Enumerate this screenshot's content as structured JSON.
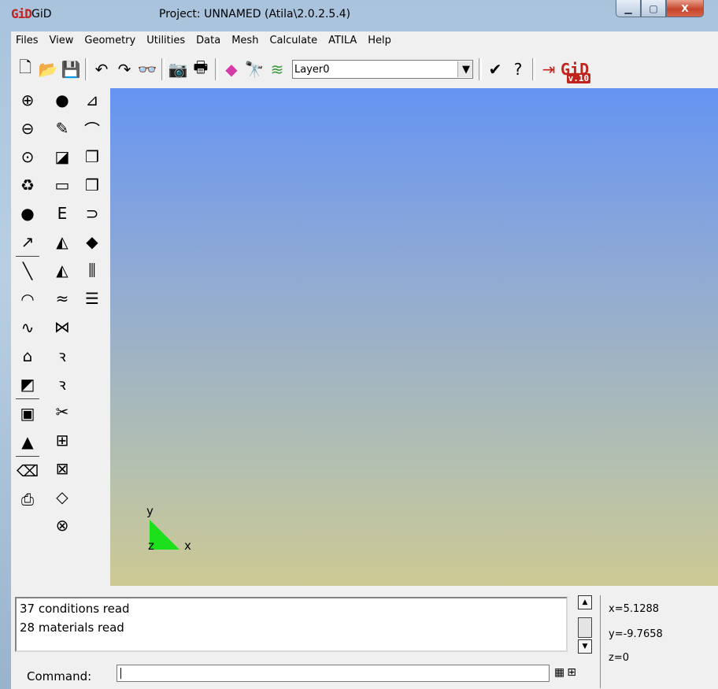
{
  "window": {
    "logo": "GiD",
    "app_name": "GiD",
    "title": "Project: UNNAMED (Atila\\2.0.2.5.4)",
    "buttons": {
      "minimize": "▁",
      "maximize": "▢",
      "close": "X"
    }
  },
  "menu": [
    "Files",
    "View",
    "Geometry",
    "Utilities",
    "Data",
    "Mesh",
    "Calculate",
    "ATILA",
    "Help"
  ],
  "toolbar": {
    "layer_select": "Layer0",
    "logo_version": "v.10",
    "icons_left": [
      {
        "name": "new-file-icon",
        "glyph": "🗋"
      },
      {
        "name": "open-folder-icon",
        "glyph": "📂"
      },
      {
        "name": "save-icon",
        "glyph": "💾"
      },
      {
        "name": "undo-view-icon",
        "glyph": "↶"
      },
      {
        "name": "redo-view-icon",
        "glyph": "↷"
      },
      {
        "name": "view-glasses-icon",
        "glyph": "👓"
      },
      {
        "name": "camera-icon",
        "glyph": "📷"
      },
      {
        "name": "print-icon",
        "glyph": "🖶"
      },
      {
        "name": "rainbow-render-icon",
        "glyph": "◆"
      },
      {
        "name": "binoculars-icon",
        "glyph": "🔭"
      },
      {
        "name": "layers-icon",
        "glyph": "≋"
      }
    ],
    "icons_right": [
      {
        "name": "check-icon",
        "glyph": "✔"
      },
      {
        "name": "help-icon",
        "glyph": "?"
      },
      {
        "name": "exit-icon",
        "glyph": "⇥"
      }
    ]
  },
  "leftbar": {
    "col1": [
      {
        "name": "zoom-in-icon",
        "glyph": "⊕"
      },
      {
        "name": "zoom-out-icon",
        "glyph": "⊖"
      },
      {
        "name": "zoom-frame-icon",
        "glyph": "⊙"
      },
      {
        "name": "redraw-recycle-icon",
        "glyph": "♻"
      },
      {
        "name": "render-sphere-icon",
        "glyph": "●"
      },
      {
        "name": "point-arrow-icon",
        "glyph": "↗"
      },
      {
        "name": "line-icon",
        "glyph": "╲"
      },
      {
        "name": "arc-icon",
        "glyph": "◠"
      },
      {
        "name": "nurbs-curve-icon",
        "glyph": "∿"
      },
      {
        "name": "polyline-icon",
        "glyph": "⌂"
      },
      {
        "name": "surface-icon",
        "glyph": "◩"
      },
      {
        "name": "volume-box-icon",
        "glyph": "▣"
      },
      {
        "name": "solid-shapes-icon",
        "glyph": "▲"
      },
      {
        "name": "eraser-icon",
        "glyph": "⌫"
      },
      {
        "name": "list-entities-icon",
        "glyph": "⎙"
      }
    ],
    "col2": [
      {
        "name": "point-icon",
        "glyph": "●"
      },
      {
        "name": "edit-note-icon",
        "glyph": "✎"
      },
      {
        "name": "eraser-small-icon",
        "glyph": "◪"
      },
      {
        "name": "select-box-icon",
        "glyph": "▭"
      },
      {
        "name": "label-e-icon",
        "glyph": "E"
      },
      {
        "name": "surface-patch-icon",
        "glyph": "◭"
      },
      {
        "name": "surface-patch-2-icon",
        "glyph": "◭"
      },
      {
        "name": "sweep-surface-icon",
        "glyph": "≈"
      },
      {
        "name": "intersect-icon",
        "glyph": "⋈"
      },
      {
        "name": "divide-curve-icon",
        "glyph": "ꝛ"
      },
      {
        "name": "divide-curve-2-icon",
        "glyph": "ꝛ"
      },
      {
        "name": "cut-scissors-icon",
        "glyph": "✂"
      },
      {
        "name": "structured-mesh-icon",
        "glyph": "⊞"
      },
      {
        "name": "mesh-quad-icon",
        "glyph": "⊠"
      },
      {
        "name": "mesh-tri-icon",
        "glyph": "◇"
      },
      {
        "name": "mesh-volume-icon",
        "glyph": "⊗"
      }
    ],
    "col3": [
      {
        "name": "condition-assign-icon",
        "glyph": "⊿"
      },
      {
        "name": "material-curve-icon",
        "glyph": "⌒"
      },
      {
        "name": "material-box-icon",
        "glyph": "❐"
      },
      {
        "name": "material-cube-icon",
        "glyph": "❒"
      },
      {
        "name": "material-magnet-icon",
        "glyph": "⊃"
      },
      {
        "name": "material-drop-icon",
        "glyph": "◆"
      },
      {
        "name": "frequency-icon",
        "glyph": "⫼"
      },
      {
        "name": "probe-icon",
        "glyph": "☰"
      }
    ]
  },
  "viewport": {
    "axis_labels": {
      "x": "x",
      "y": "y",
      "z": "z"
    }
  },
  "log": [
    "37 conditions read",
    "28 materials read"
  ],
  "coords": {
    "x": "x=5.1288",
    "y": "y=-9.7658",
    "z": "z=0"
  },
  "command": {
    "label": "Command:",
    "value": ""
  }
}
